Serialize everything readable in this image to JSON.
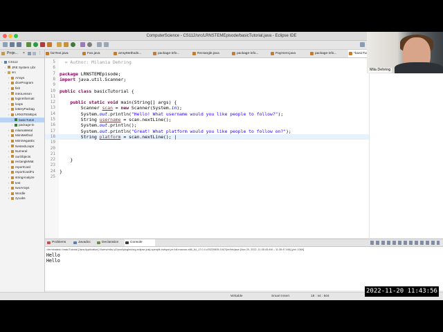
{
  "window": {
    "title": "ComputerScience - CS112/src/LRNSTEMEpisode/basicTutorial.java - Eclipse IDE"
  },
  "sidebar": {
    "tab_label": "Proje...",
    "items": [
      {
        "label": "CS112",
        "indent": 0,
        "icon": "project-icon",
        "selected": false
      },
      {
        "label": "JRE System Libr",
        "indent": 1,
        "icon": "library-icon",
        "selected": false
      },
      {
        "label": "src",
        "indent": 1,
        "icon": "folder-icon",
        "selected": false
      },
      {
        "label": "Arrays",
        "indent": 2,
        "icon": "package-icon",
        "selected": false
      },
      {
        "label": "diceProgram",
        "indent": 2,
        "icon": "package-icon",
        "selected": false
      },
      {
        "label": "fish",
        "indent": 2,
        "icon": "package-icon",
        "selected": false
      },
      {
        "label": "introLesson",
        "indent": 2,
        "icon": "package-icon",
        "selected": false
      },
      {
        "label": "loginInformati",
        "indent": 2,
        "icon": "package-icon",
        "selected": false
      },
      {
        "label": "loops",
        "indent": 2,
        "icon": "package-icon",
        "selected": false
      },
      {
        "label": "lotteryPackag",
        "indent": 2,
        "icon": "package-icon",
        "selected": false
      },
      {
        "label": "LRNSTEMEpis",
        "indent": 2,
        "icon": "package-icon",
        "selected": false
      },
      {
        "label": "basicTutori",
        "indent": 3,
        "icon": "java-file-icon",
        "selected": true
      },
      {
        "label": "package-in",
        "indent": 3,
        "icon": "java-file-icon",
        "selected": false
      },
      {
        "label": "mlamaMetal",
        "indent": 2,
        "icon": "package-icon",
        "selected": false
      },
      {
        "label": "MimiMethod",
        "indent": 2,
        "icon": "package-icon",
        "selected": false
      },
      {
        "label": "MimiVegasEx",
        "indent": 2,
        "icon": "package-icon",
        "selected": false
      },
      {
        "label": "NestedLoops",
        "indent": 2,
        "icon": "package-icon",
        "selected": false
      },
      {
        "label": "Numeral",
        "indent": 2,
        "icon": "package-icon",
        "selected": false
      },
      {
        "label": "ourObjects",
        "indent": 2,
        "icon": "package-icon",
        "selected": false
      },
      {
        "label": "rectangleMat",
        "indent": 2,
        "icon": "package-icon",
        "selected": false
      },
      {
        "label": "reportCard",
        "indent": 2,
        "icon": "package-icon",
        "selected": false
      },
      {
        "label": "reportCardFu",
        "indent": 2,
        "icon": "package-icon",
        "selected": false
      },
      {
        "label": "stringAnalyze",
        "indent": 2,
        "icon": "package-icon",
        "selected": false
      },
      {
        "label": "test",
        "indent": 2,
        "icon": "package-icon",
        "selected": false
      },
      {
        "label": "twoArrays",
        "indent": 2,
        "icon": "package-icon",
        "selected": false
      },
      {
        "label": "Wordle",
        "indent": 2,
        "icon": "package-icon",
        "selected": false
      },
      {
        "label": "zyLabs",
        "indent": 2,
        "icon": "package-icon",
        "selected": false
      }
    ]
  },
  "editor_tabs": [
    {
      "label": "fanText.java",
      "active": false
    },
    {
      "label": "Fan.java",
      "active": false
    },
    {
      "label": "arrayMethods...",
      "active": false
    },
    {
      "label": "package-info...",
      "active": false
    },
    {
      "label": "Rectangle.java",
      "active": false
    },
    {
      "label": "package-info...",
      "active": false
    },
    {
      "label": "Payment.java",
      "active": false
    },
    {
      "label": "package-info...",
      "active": false
    },
    {
      "label": "*basicTuto",
      "active": true
    }
  ],
  "editor": {
    "lines": [
      {
        "num": "5",
        "tokens": [
          {
            "t": "  = Author: Milania Dehring",
            "c": "muted"
          }
        ]
      },
      {
        "num": "6",
        "tokens": []
      },
      {
        "num": "7",
        "tokens": [
          {
            "t": "package ",
            "c": "kw"
          },
          {
            "t": "LRNSTEMEpisode;",
            "c": ""
          }
        ]
      },
      {
        "num": "8",
        "tokens": [
          {
            "t": "import ",
            "c": "kw"
          },
          {
            "t": "java.util.Scanner;",
            "c": ""
          }
        ]
      },
      {
        "num": "9",
        "tokens": []
      },
      {
        "num": "10",
        "tokens": [
          {
            "t": "public class ",
            "c": "kw"
          },
          {
            "t": "basicTutorial {",
            "c": ""
          }
        ]
      },
      {
        "num": "11",
        "tokens": []
      },
      {
        "num": "12",
        "tokens": [
          {
            "t": "    public static void ",
            "c": "kw"
          },
          {
            "t": "main(String[] args) {",
            "c": ""
          }
        ]
      },
      {
        "num": "13",
        "tokens": [
          {
            "t": "        Scanner ",
            "c": ""
          },
          {
            "t": "scan",
            "c": "var"
          },
          {
            "t": " = ",
            "c": ""
          },
          {
            "t": "new ",
            "c": "kw"
          },
          {
            "t": "Scanner(System.",
            "c": ""
          },
          {
            "t": "in",
            "c": "fld"
          },
          {
            "t": ");",
            "c": ""
          }
        ]
      },
      {
        "num": "14",
        "tokens": [
          {
            "t": "        System.",
            "c": ""
          },
          {
            "t": "out",
            "c": "fld"
          },
          {
            "t": ".println(",
            "c": ""
          },
          {
            "t": "\"Hello! What username would you like people to follow?\"",
            "c": "str"
          },
          {
            "t": ");",
            "c": ""
          }
        ]
      },
      {
        "num": "15",
        "tokens": [
          {
            "t": "        String ",
            "c": ""
          },
          {
            "t": "username",
            "c": "var"
          },
          {
            "t": " = scan.nextLine();",
            "c": ""
          }
        ]
      },
      {
        "num": "16",
        "tokens": [
          {
            "t": "        System.",
            "c": ""
          },
          {
            "t": "out",
            "c": "fld"
          },
          {
            "t": ".println();",
            "c": ""
          }
        ]
      },
      {
        "num": "17",
        "tokens": [
          {
            "t": "        System.",
            "c": ""
          },
          {
            "t": "out",
            "c": "fld"
          },
          {
            "t": ".println(",
            "c": ""
          },
          {
            "t": "\"Great! What platform would you like people to follow on?\"",
            "c": "str"
          },
          {
            "t": ");",
            "c": ""
          }
        ]
      },
      {
        "num": "18",
        "tokens": [
          {
            "t": "        String ",
            "c": ""
          },
          {
            "t": "platform",
            "c": "var"
          },
          {
            "t": " = scan.nextLine(); |",
            "c": ""
          }
        ]
      },
      {
        "num": "19",
        "tokens": []
      },
      {
        "num": "20",
        "tokens": []
      },
      {
        "num": "21",
        "tokens": []
      },
      {
        "num": "22",
        "tokens": [
          {
            "t": "    }",
            "c": ""
          }
        ]
      },
      {
        "num": "23",
        "tokens": []
      },
      {
        "num": "24",
        "tokens": [
          {
            "t": "}",
            "c": ""
          }
        ]
      },
      {
        "num": "25",
        "tokens": []
      }
    ]
  },
  "console": {
    "tabs": [
      {
        "label": "Problems",
        "icon": "problems-icon",
        "active": false
      },
      {
        "label": "Javadoc",
        "icon": "javadoc-icon",
        "active": false
      },
      {
        "label": "Declaration",
        "icon": "declaration-icon",
        "active": false
      },
      {
        "label": "Console",
        "icon": "console-icon",
        "active": true
      }
    ],
    "info": "<terminated> basicTutorial [Java Application] /Users/mila/.p2/pool/plugins/org.eclipse.justj.openjdk.hotspot.jre.full.macosx.x86_64_17.0.4.v20220805-1047/jre/bin/java  (Nov 20, 2022, 11:35:45 AM – 11:35:47 AM) [pid: 1069]",
    "output": [
      "Hello",
      "Hello"
    ]
  },
  "status": {
    "writable": "Writable",
    "insert_mode": "Smart Insert",
    "position": "18 : 44 : 504"
  },
  "webcam": {
    "name": "Mila Dehring"
  },
  "timestamp": "2022-11-20 11:43:56"
}
